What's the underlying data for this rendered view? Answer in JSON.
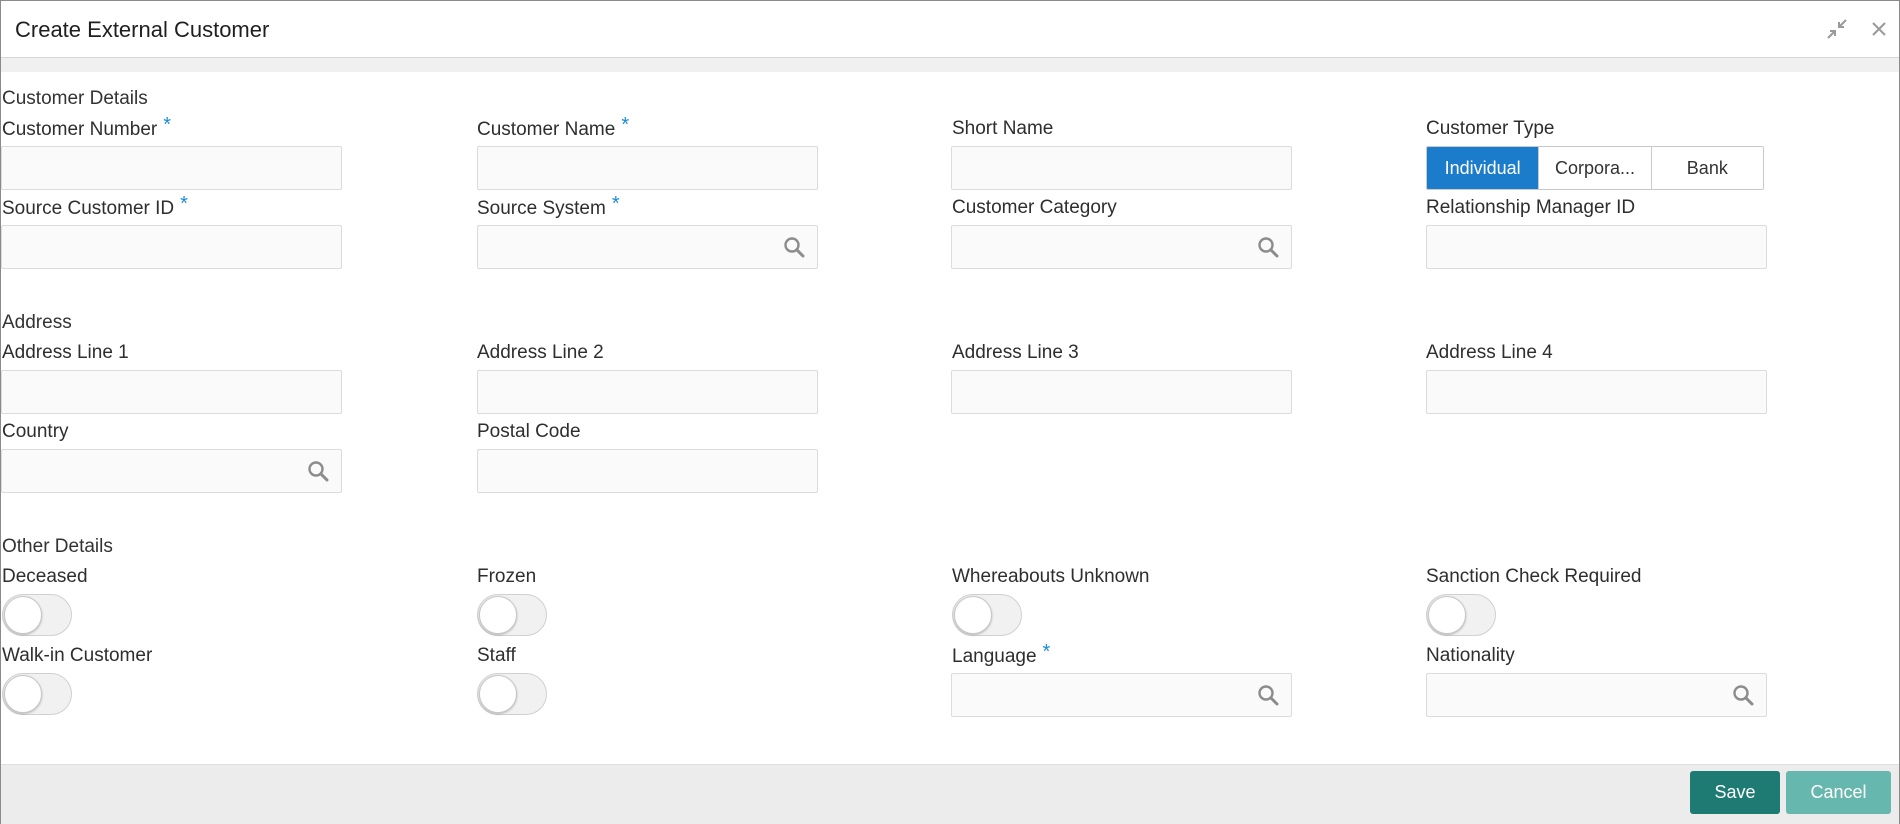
{
  "window": {
    "title": "Create External Customer",
    "shrink_icon": "shrink-icon",
    "close_icon": "close-icon"
  },
  "sections": {
    "customer_details": "Customer Details",
    "address": "Address",
    "other_details": "Other Details"
  },
  "fields": {
    "customer_number": {
      "label": "Customer Number",
      "required": "*",
      "value": ""
    },
    "customer_name": {
      "label": "Customer Name",
      "required": "*",
      "value": ""
    },
    "short_name": {
      "label": "Short Name",
      "value": ""
    },
    "customer_type": {
      "label": "Customer Type",
      "options": [
        "Individual",
        "Corpora...",
        "Bank"
      ],
      "selected": "Individual"
    },
    "source_customer_id": {
      "label": "Source Customer ID",
      "required": "*",
      "value": ""
    },
    "source_system": {
      "label": "Source System",
      "required": "*",
      "value": ""
    },
    "customer_category": {
      "label": "Customer Category",
      "value": ""
    },
    "relationship_manager_id": {
      "label": "Relationship Manager ID",
      "value": ""
    },
    "address_line_1": {
      "label": "Address Line 1",
      "value": ""
    },
    "address_line_2": {
      "label": "Address Line 2",
      "value": ""
    },
    "address_line_3": {
      "label": "Address Line 3",
      "value": ""
    },
    "address_line_4": {
      "label": "Address Line 4",
      "value": ""
    },
    "country": {
      "label": "Country",
      "value": ""
    },
    "postal_code": {
      "label": "Postal Code",
      "value": ""
    },
    "deceased": {
      "label": "Deceased",
      "on": false
    },
    "frozen": {
      "label": "Frozen",
      "on": false
    },
    "whereabouts_unknown": {
      "label": "Whereabouts Unknown",
      "on": false
    },
    "sanction_check_required": {
      "label": "Sanction Check Required",
      "on": false
    },
    "walk_in_customer": {
      "label": "Walk-in Customer",
      "on": false
    },
    "staff": {
      "label": "Staff",
      "on": false
    },
    "language": {
      "label": "Language",
      "required": "*",
      "value": ""
    },
    "nationality": {
      "label": "Nationality",
      "value": ""
    }
  },
  "footer": {
    "save_label": "Save",
    "cancel_label": "Cancel"
  },
  "colors": {
    "accent": "#1a7ccb",
    "required": "#1a8bd6",
    "save": "#1e7b73",
    "cancel": "#66b7ad"
  }
}
